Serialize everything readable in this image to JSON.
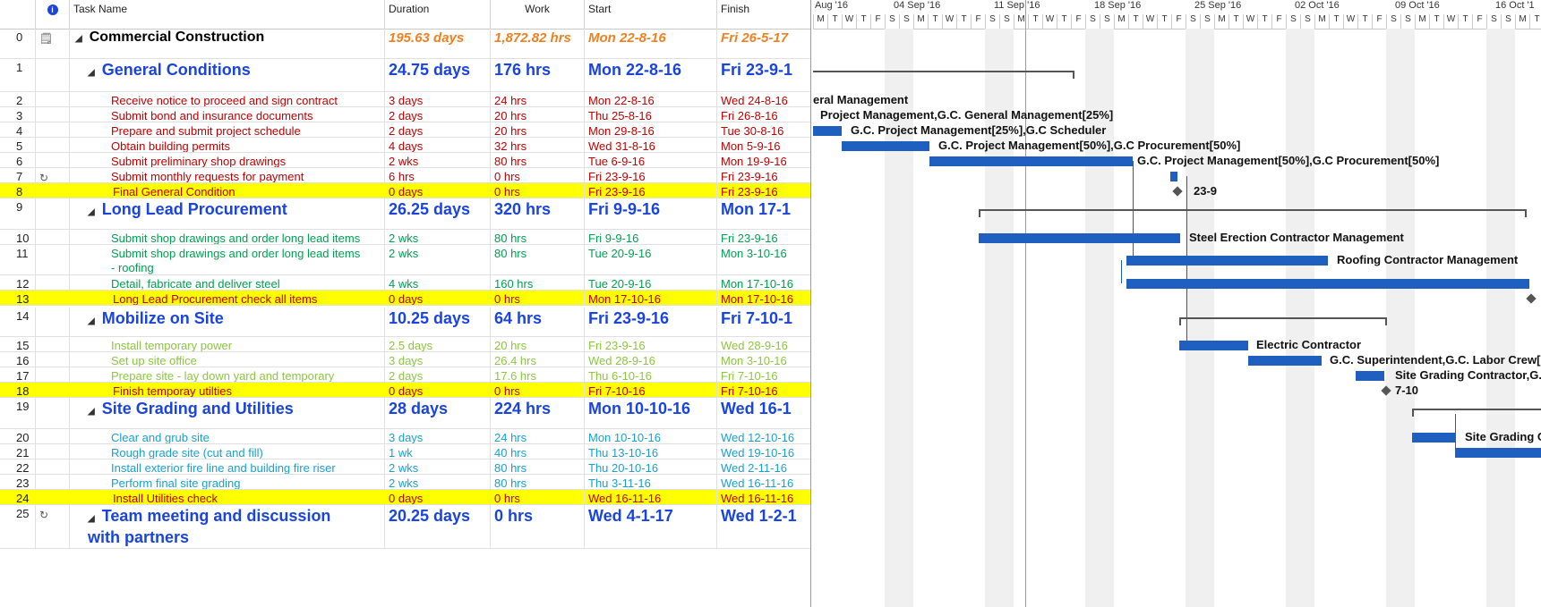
{
  "columns": {
    "info_icon": "info-icon",
    "task_name": "Task Name",
    "duration": "Duration",
    "work": "Work",
    "start": "Start",
    "finish": "Finish"
  },
  "colors": {
    "red": "#c00000",
    "blue": "#1a44e0",
    "green": "#00a050",
    "lightgreen": "#8cc63f",
    "cyan": "#1aa0d0",
    "orange": "#f08020",
    "highlight": "#ffff00",
    "bar": "#1f5fbf"
  },
  "rows": [
    {
      "id": "0",
      "name": "Commercial Construction",
      "duration": "195.63 days",
      "work": "1,872.82 hrs",
      "start": "Mon 22-8-16",
      "finish": "Fri 26-5-17",
      "style": "top",
      "indicator": "note-icon"
    },
    {
      "id": "1",
      "name": "General Conditions",
      "duration": "24.75 days",
      "work": "176 hrs",
      "start": "Mon 22-8-16",
      "finish": "Fri 23-9-1",
      "style": "summary",
      "indicator": ""
    },
    {
      "id": "2",
      "name": "Receive notice to proceed and sign contract",
      "duration": "3 days",
      "work": "24 hrs",
      "start": "Mon 22-8-16",
      "finish": "Wed 24-8-16",
      "style": "red",
      "indicator": ""
    },
    {
      "id": "3",
      "name": "Submit bond and insurance documents",
      "duration": "2 days",
      "work": "20 hrs",
      "start": "Thu 25-8-16",
      "finish": "Fri 26-8-16",
      "style": "red",
      "indicator": ""
    },
    {
      "id": "4",
      "name": "Prepare and submit project schedule",
      "duration": "2 days",
      "work": "20 hrs",
      "start": "Mon 29-8-16",
      "finish": "Tue 30-8-16",
      "style": "red",
      "indicator": ""
    },
    {
      "id": "5",
      "name": "Obtain building permits",
      "duration": "4 days",
      "work": "32 hrs",
      "start": "Wed 31-8-16",
      "finish": "Mon 5-9-16",
      "style": "red",
      "indicator": ""
    },
    {
      "id": "6",
      "name": "Submit preliminary shop drawings",
      "duration": "2 wks",
      "work": "80 hrs",
      "start": "Tue 6-9-16",
      "finish": "Mon 19-9-16",
      "style": "red",
      "indicator": ""
    },
    {
      "id": "7",
      "name": "Submit monthly requests for payment",
      "duration": "6 hrs",
      "work": "0 hrs",
      "start": "Fri 23-9-16",
      "finish": "Fri 23-9-16",
      "style": "red",
      "indicator": "recurring-task-icon"
    },
    {
      "id": "8",
      "name": "Final General Condition",
      "duration": "0 days",
      "work": "0 hrs",
      "start": "Fri 23-9-16",
      "finish": "Fri 23-9-16",
      "style": "milestone",
      "indicator": ""
    },
    {
      "id": "9",
      "name": "Long Lead Procurement",
      "duration": "26.25 days",
      "work": "320 hrs",
      "start": "Fri 9-9-16",
      "finish": "Mon 17-1",
      "style": "summary",
      "indicator": ""
    },
    {
      "id": "10",
      "name": "Submit shop drawings and order long lead items",
      "duration": "2 wks",
      "work": "80 hrs",
      "start": "Fri 9-9-16",
      "finish": "Fri 23-9-16",
      "style": "green",
      "indicator": ""
    },
    {
      "id": "11",
      "name": "Submit shop drawings and order long lead items",
      "name2": "- roofing",
      "duration": "2 wks",
      "work": "80 hrs",
      "start": "Tue 20-9-16",
      "finish": "Mon 3-10-16",
      "style": "green",
      "indicator": ""
    },
    {
      "id": "12",
      "name": "Detail, fabricate and deliver steel",
      "duration": "4 wks",
      "work": "160 hrs",
      "start": "Tue 20-9-16",
      "finish": "Mon 17-10-16",
      "style": "green",
      "indicator": ""
    },
    {
      "id": "13",
      "name": "Long Lead Procurement check all items",
      "duration": "0 days",
      "work": "0 hrs",
      "start": "Mon 17-10-16",
      "finish": "Mon 17-10-16",
      "style": "milestone",
      "indicator": ""
    },
    {
      "id": "14",
      "name": "Mobilize on Site",
      "duration": "10.25 days",
      "work": "64 hrs",
      "start": "Fri 23-9-16",
      "finish": "Fri 7-10-1",
      "style": "summary",
      "indicator": ""
    },
    {
      "id": "15",
      "name": "Install temporary power",
      "duration": "2.5 days",
      "work": "20 hrs",
      "start": "Fri 23-9-16",
      "finish": "Wed 28-9-16",
      "style": "lightgreen",
      "indicator": ""
    },
    {
      "id": "16",
      "name": "Set up site office",
      "duration": "3 days",
      "work": "26.4 hrs",
      "start": "Wed 28-9-16",
      "finish": "Mon 3-10-16",
      "style": "lightgreen",
      "indicator": ""
    },
    {
      "id": "17",
      "name": "Prepare site - lay down yard and temporary",
      "duration": "2 days",
      "work": "17.6 hrs",
      "start": "Thu 6-10-16",
      "finish": "Fri 7-10-16",
      "style": "lightgreen",
      "indicator": ""
    },
    {
      "id": "18",
      "name": "Finish temporay utilties",
      "duration": "0 days",
      "work": "0 hrs",
      "start": "Fri 7-10-16",
      "finish": "Fri 7-10-16",
      "style": "milestone",
      "indicator": ""
    },
    {
      "id": "19",
      "name": "Site Grading and Utilities",
      "duration": "28 days",
      "work": "224 hrs",
      "start": "Mon 10-10-16",
      "finish": "Wed 16-1",
      "style": "summary",
      "indicator": ""
    },
    {
      "id": "20",
      "name": "Clear and grub site",
      "duration": "3 days",
      "work": "24 hrs",
      "start": "Mon 10-10-16",
      "finish": "Wed 12-10-16",
      "style": "cyan",
      "indicator": ""
    },
    {
      "id": "21",
      "name": "Rough grade site (cut and fill)",
      "duration": "1 wk",
      "work": "40 hrs",
      "start": "Thu 13-10-16",
      "finish": "Wed 19-10-16",
      "style": "cyan",
      "indicator": ""
    },
    {
      "id": "22",
      "name": "Install exterior fire line and building fire riser",
      "duration": "2 wks",
      "work": "80 hrs",
      "start": "Thu 20-10-16",
      "finish": "Wed 2-11-16",
      "style": "cyan",
      "indicator": ""
    },
    {
      "id": "23",
      "name": "Perform final site grading",
      "duration": "2 wks",
      "work": "80 hrs",
      "start": "Thu 3-11-16",
      "finish": "Wed 16-11-16",
      "style": "cyan",
      "indicator": ""
    },
    {
      "id": "24",
      "name": "Install Utilities check",
      "duration": "0 days",
      "work": "0 hrs",
      "start": "Wed 16-11-16",
      "finish": "Wed 16-11-16",
      "style": "milestone",
      "indicator": ""
    },
    {
      "id": "25",
      "name": "Team meeting and discussion",
      "name2": "with partners",
      "duration": "20.25 days",
      "work": "0 hrs",
      "start": "Wed 4-1-17",
      "finish": "Wed 1-2-1",
      "style": "summary",
      "indicator": "recurring-task-icon"
    }
  ],
  "timescale": {
    "weeks": [
      "Aug '16",
      "04 Sep '16",
      "11 Sep '16",
      "18 Sep '16",
      "25 Sep '16",
      "02 Oct '16",
      "09 Oct '16",
      "16 Oct '1"
    ],
    "days": [
      "M",
      "T",
      "W",
      "T",
      "F",
      "S",
      "S"
    ]
  },
  "gantt_labels": {
    "r2": "eral Management",
    "r3": "Project Management,G.C. General Management[25%]",
    "r4": "G.C. Project Management[25%],G.C Scheduler",
    "r5": "G.C. Project Management[50%],G.C Procurement[50%]",
    "r6": "G.C. Project Management[50%],G.C Procurement[50%]",
    "r8": "23-9",
    "r10": "Steel Erection Contractor Management",
    "r11": "Roofing Contractor Management",
    "r15": "Electric Contractor",
    "r16": "G.C. Superintendent,G.C. Labor Crew[1",
    "r17": "Site Grading Contractor,G.",
    "r18": "7-10",
    "r20": "Site Grading C"
  }
}
